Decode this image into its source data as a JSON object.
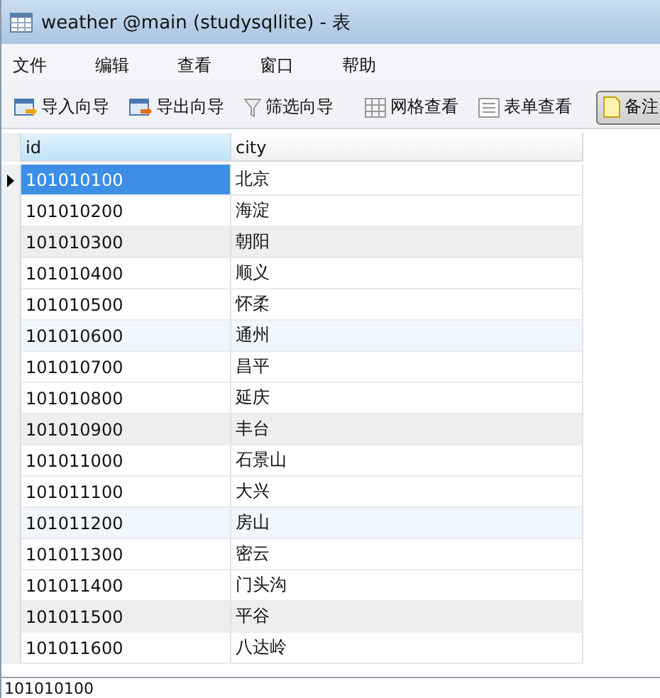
{
  "window": {
    "title": "weather @main (studysqllite) - 表"
  },
  "menu": [
    "文件",
    "编辑",
    "查看",
    "窗口",
    "帮助"
  ],
  "toolbar": [
    {
      "kind": "import",
      "label": "导入向导",
      "pressed": false
    },
    {
      "kind": "export",
      "label": "导出向导",
      "pressed": false
    },
    {
      "kind": "filter",
      "label": "筛选向导",
      "pressed": false
    },
    {
      "kind": "separator"
    },
    {
      "kind": "grid",
      "label": "网格查看",
      "pressed": false
    },
    {
      "kind": "form",
      "label": "表单查看",
      "pressed": false
    },
    {
      "kind": "separator"
    },
    {
      "kind": "note",
      "label": "备注",
      "pressed": true
    }
  ],
  "table": {
    "columns": [
      "id",
      "city"
    ],
    "rows": [
      {
        "id": "101010100",
        "city": "北京",
        "selected": true,
        "color": "#ffffff"
      },
      {
        "id": "101010200",
        "city": "海淀",
        "selected": false,
        "color": "#ffffff"
      },
      {
        "id": "101010300",
        "city": "朝阳",
        "selected": false,
        "color": "#eeeeee"
      },
      {
        "id": "101010400",
        "city": "顺义",
        "selected": false,
        "color": "#ffffff"
      },
      {
        "id": "101010500",
        "city": "怀柔",
        "selected": false,
        "color": "#ffffff"
      },
      {
        "id": "101010600",
        "city": "通州",
        "selected": false,
        "color": "#f0f6fc"
      },
      {
        "id": "101010700",
        "city": "昌平",
        "selected": false,
        "color": "#ffffff"
      },
      {
        "id": "101010800",
        "city": "延庆",
        "selected": false,
        "color": "#ffffff"
      },
      {
        "id": "101010900",
        "city": "丰台",
        "selected": false,
        "color": "#eeeeee"
      },
      {
        "id": "101011000",
        "city": "石景山",
        "selected": false,
        "color": "#ffffff"
      },
      {
        "id": "101011100",
        "city": "大兴",
        "selected": false,
        "color": "#ffffff"
      },
      {
        "id": "101011200",
        "city": "房山",
        "selected": false,
        "color": "#f0f6fc"
      },
      {
        "id": "101011300",
        "city": "密云",
        "selected": false,
        "color": "#ffffff"
      },
      {
        "id": "101011400",
        "city": "门头沟",
        "selected": false,
        "color": "#ffffff"
      },
      {
        "id": "101011500",
        "city": "平谷",
        "selected": false,
        "color": "#eeeeee"
      },
      {
        "id": "101011600",
        "city": "八达岭",
        "selected": false,
        "color": "#ffffff"
      }
    ]
  },
  "status_bar": {
    "value": "101010100"
  }
}
